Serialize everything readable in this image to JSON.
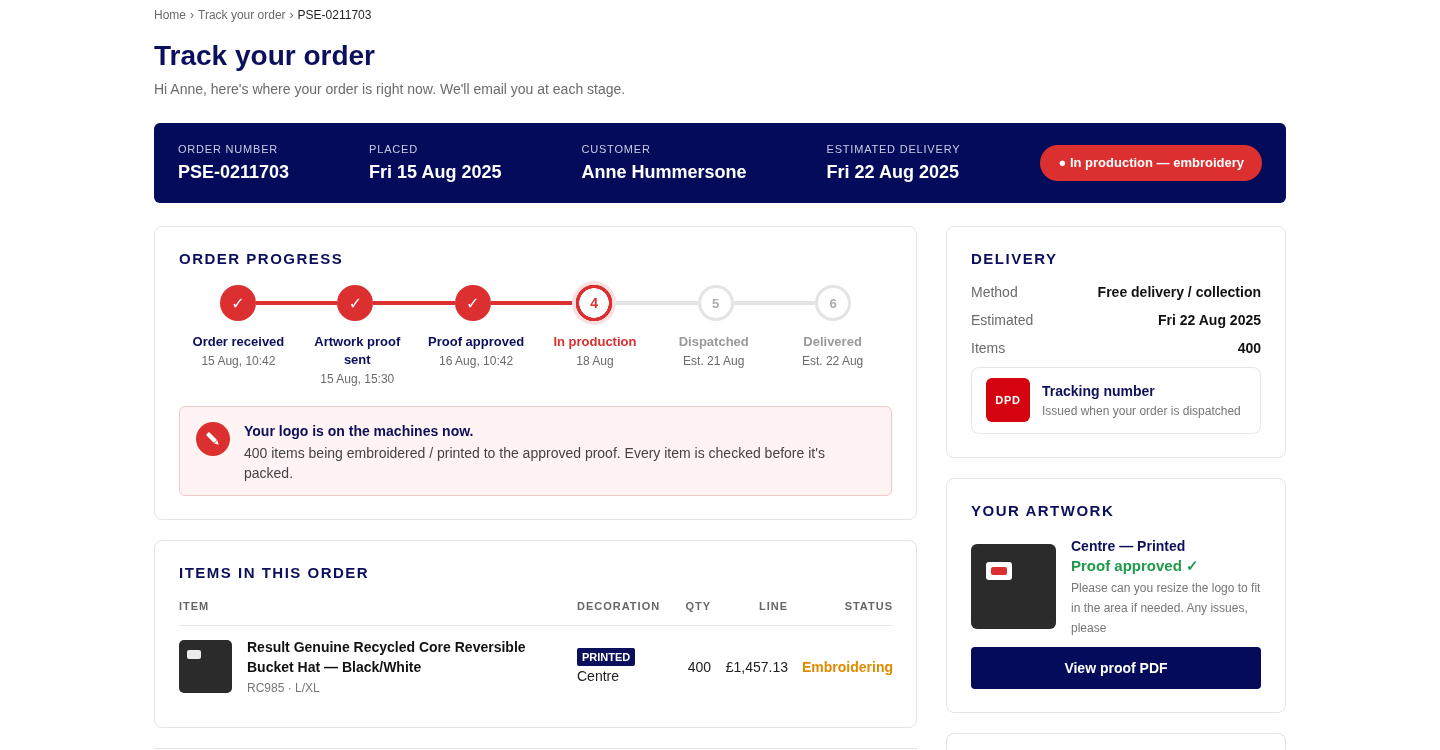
{
  "breadcrumb": [
    {
      "label": "Home",
      "separator": "›",
      "current": false
    },
    {
      "label": "Track your order",
      "separator": "›",
      "current": false
    },
    {
      "label": "PSE-0211703",
      "current": true
    }
  ],
  "page": {
    "title": "Track your order",
    "subtitle": "Hi Anne, here's where your order is right now. We'll email you at each stage."
  },
  "summary": {
    "fields": [
      {
        "label": "ORDER NUMBER",
        "value": "PSE-0211703"
      },
      {
        "label": "PLACED",
        "value": "Fri 15 Aug 2025"
      },
      {
        "label": "CUSTOMER",
        "value": "Anne Hummersone"
      },
      {
        "label": "ESTIMATED DELIVERY",
        "value": "Fri 22 Aug 2025"
      }
    ],
    "status_badge": "● In production — embroidery"
  },
  "progress": {
    "title": "ORDER PROGRESS",
    "steps": [
      {
        "marker": "✓",
        "label": "Order received",
        "date": "15 Aug, 10:42",
        "done": true,
        "current": false
      },
      {
        "marker": "✓",
        "label": "Artwork proof sent",
        "date": "15 Aug, 15:30",
        "done": true,
        "current": false
      },
      {
        "marker": "✓",
        "label": "Proof approved",
        "date": "16 Aug, 10:42",
        "done": true,
        "current": false
      },
      {
        "marker": "4",
        "label": "In production",
        "date": "18 Aug",
        "done": false,
        "current": true
      },
      {
        "marker": "5",
        "label": "Dispatched",
        "date": "Est. 21 Aug",
        "done": false,
        "current": false
      },
      {
        "marker": "6",
        "label": "Delivered",
        "date": "Est. 22 Aug",
        "done": false,
        "current": false
      }
    ],
    "alert": {
      "title": "Your logo is on the machines now.",
      "text": "400 items being embroidered / printed to the approved proof. Every item is checked before it's packed."
    }
  },
  "items": {
    "title": "ITEMS IN THIS ORDER",
    "columns": [
      "ITEM",
      "DECORATION",
      "QTY",
      "LINE",
      "STATUS"
    ],
    "rows": [
      {
        "name": "Result Genuine Recycled Core Reversible Bucket Hat — Black/White",
        "meta": "RC985 · L/XL",
        "decoration_badge": "PRINTED",
        "decoration_position": "Centre",
        "qty": "400",
        "line": "£1,457.13",
        "status": "Embroidering"
      }
    ]
  },
  "delivery": {
    "title": "DELIVERY",
    "rows": [
      {
        "label": "Method",
        "value": "Free delivery / collection"
      },
      {
        "label": "Estimated",
        "value": "Fri 22 Aug 2025"
      },
      {
        "label": "Items",
        "value": "400"
      }
    ],
    "tracking": {
      "carrier": "DPD",
      "title": "Tracking number",
      "note": "Issued when your order is dispatched"
    }
  },
  "artwork": {
    "title": "YOUR ARTWORK",
    "placement": "Centre — Printed",
    "approval": "Proof approved ✓",
    "note": "Please can you resize the logo to fit in the area if needed. Any issues, please",
    "button": "View proof PDF"
  }
}
